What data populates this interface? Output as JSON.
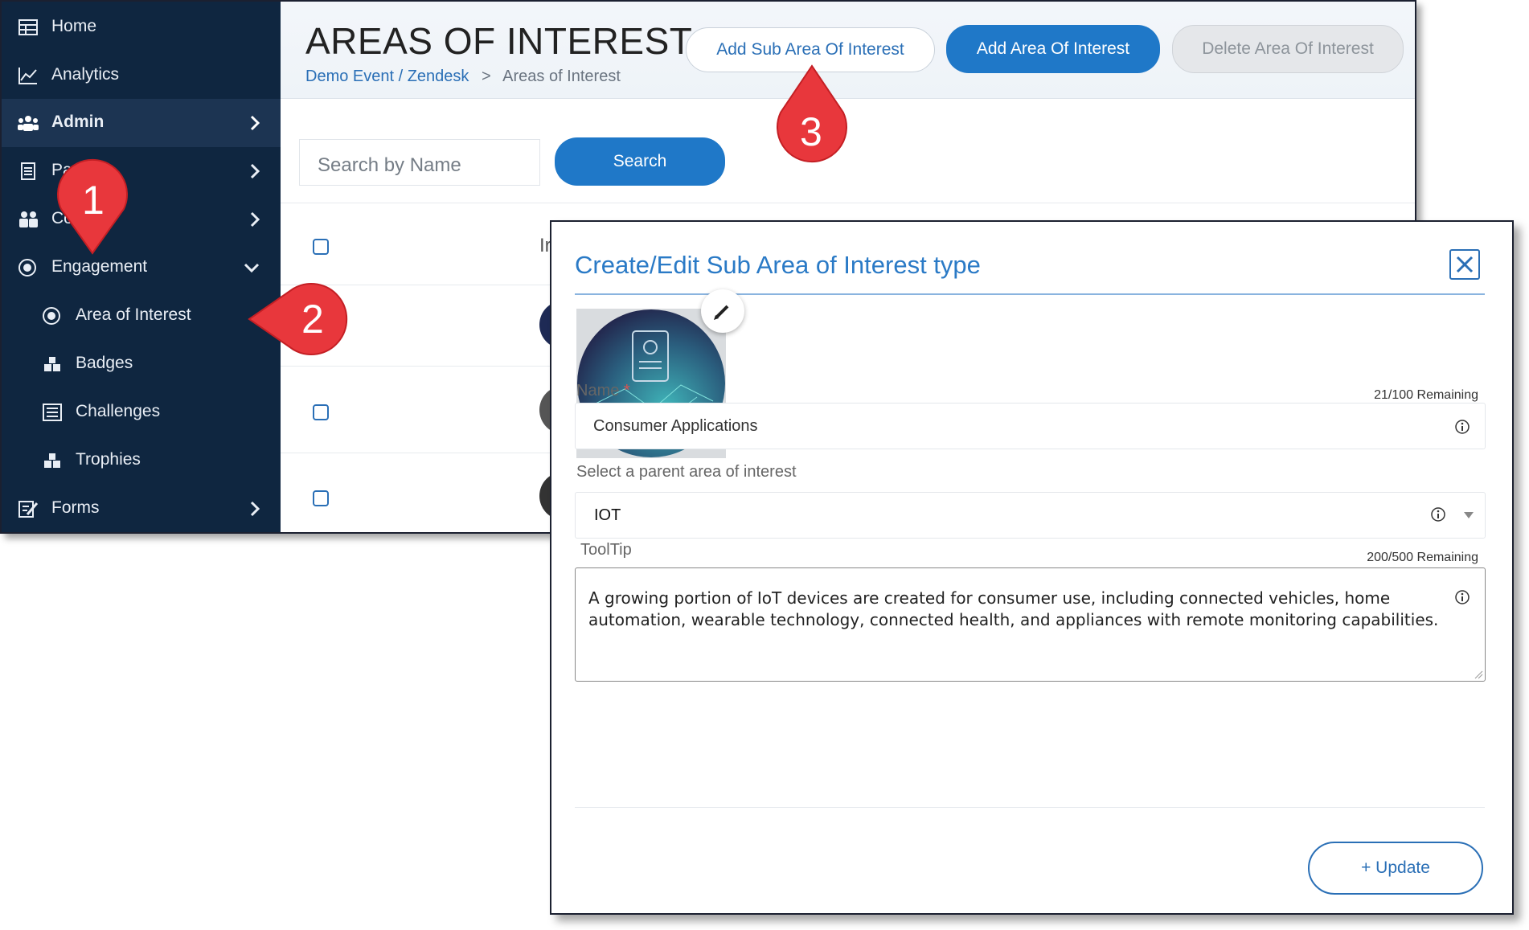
{
  "sidebar": {
    "items": [
      {
        "label": "Home",
        "icon": "table-icon"
      },
      {
        "label": "Analytics",
        "icon": "chart-icon"
      },
      {
        "label": "Admin",
        "icon": "users-icon"
      },
      {
        "label": "Pa",
        "icon": "document-icon"
      },
      {
        "label": "Co",
        "icon": "people-icon"
      },
      {
        "label": "Engagement",
        "icon": "target-icon"
      },
      {
        "label": "Area of Interest",
        "icon": "radio-icon"
      },
      {
        "label": "Badges",
        "icon": "boxes-icon"
      },
      {
        "label": "Challenges",
        "icon": "list-icon"
      },
      {
        "label": "Trophies",
        "icon": "boxes-icon"
      },
      {
        "label": "Forms",
        "icon": "form-edit-icon"
      }
    ]
  },
  "header": {
    "title": "AREAS OF INTEREST",
    "breadcrumb_link": "Demo Event / Zendesk",
    "breadcrumb_sep": ">",
    "breadcrumb_current": "Areas of Interest",
    "add_sub_label": "Add Sub Area Of Interest",
    "add_label": "Add Area Of Interest",
    "delete_label": "Delete Area Of Interest"
  },
  "search": {
    "placeholder": "Search by Name",
    "button_label": "Search"
  },
  "table": {
    "header_partial": "Ir"
  },
  "modal": {
    "title": "Create/Edit Sub Area of Interest type",
    "name_label": "Name",
    "required_mark": "*",
    "name_counter": "21/100 Remaining",
    "name_value": "Consumer Applications",
    "parent_label": "Select a parent area of interest",
    "parent_value": "IOT",
    "tooltip_label": "ToolTip",
    "tooltip_counter": "200/500 Remaining",
    "tooltip_value": "A growing portion of IoT devices are created for consumer use, including connected vehicles, home automation, wearable technology, connected health, and appliances with remote monitoring capabilities.",
    "update_label": "+ Update"
  },
  "callouts": [
    "1",
    "2",
    "3"
  ],
  "colors": {
    "sidebar": "#0f2640",
    "accent": "#1f78c8",
    "callout": "#e8373c"
  }
}
